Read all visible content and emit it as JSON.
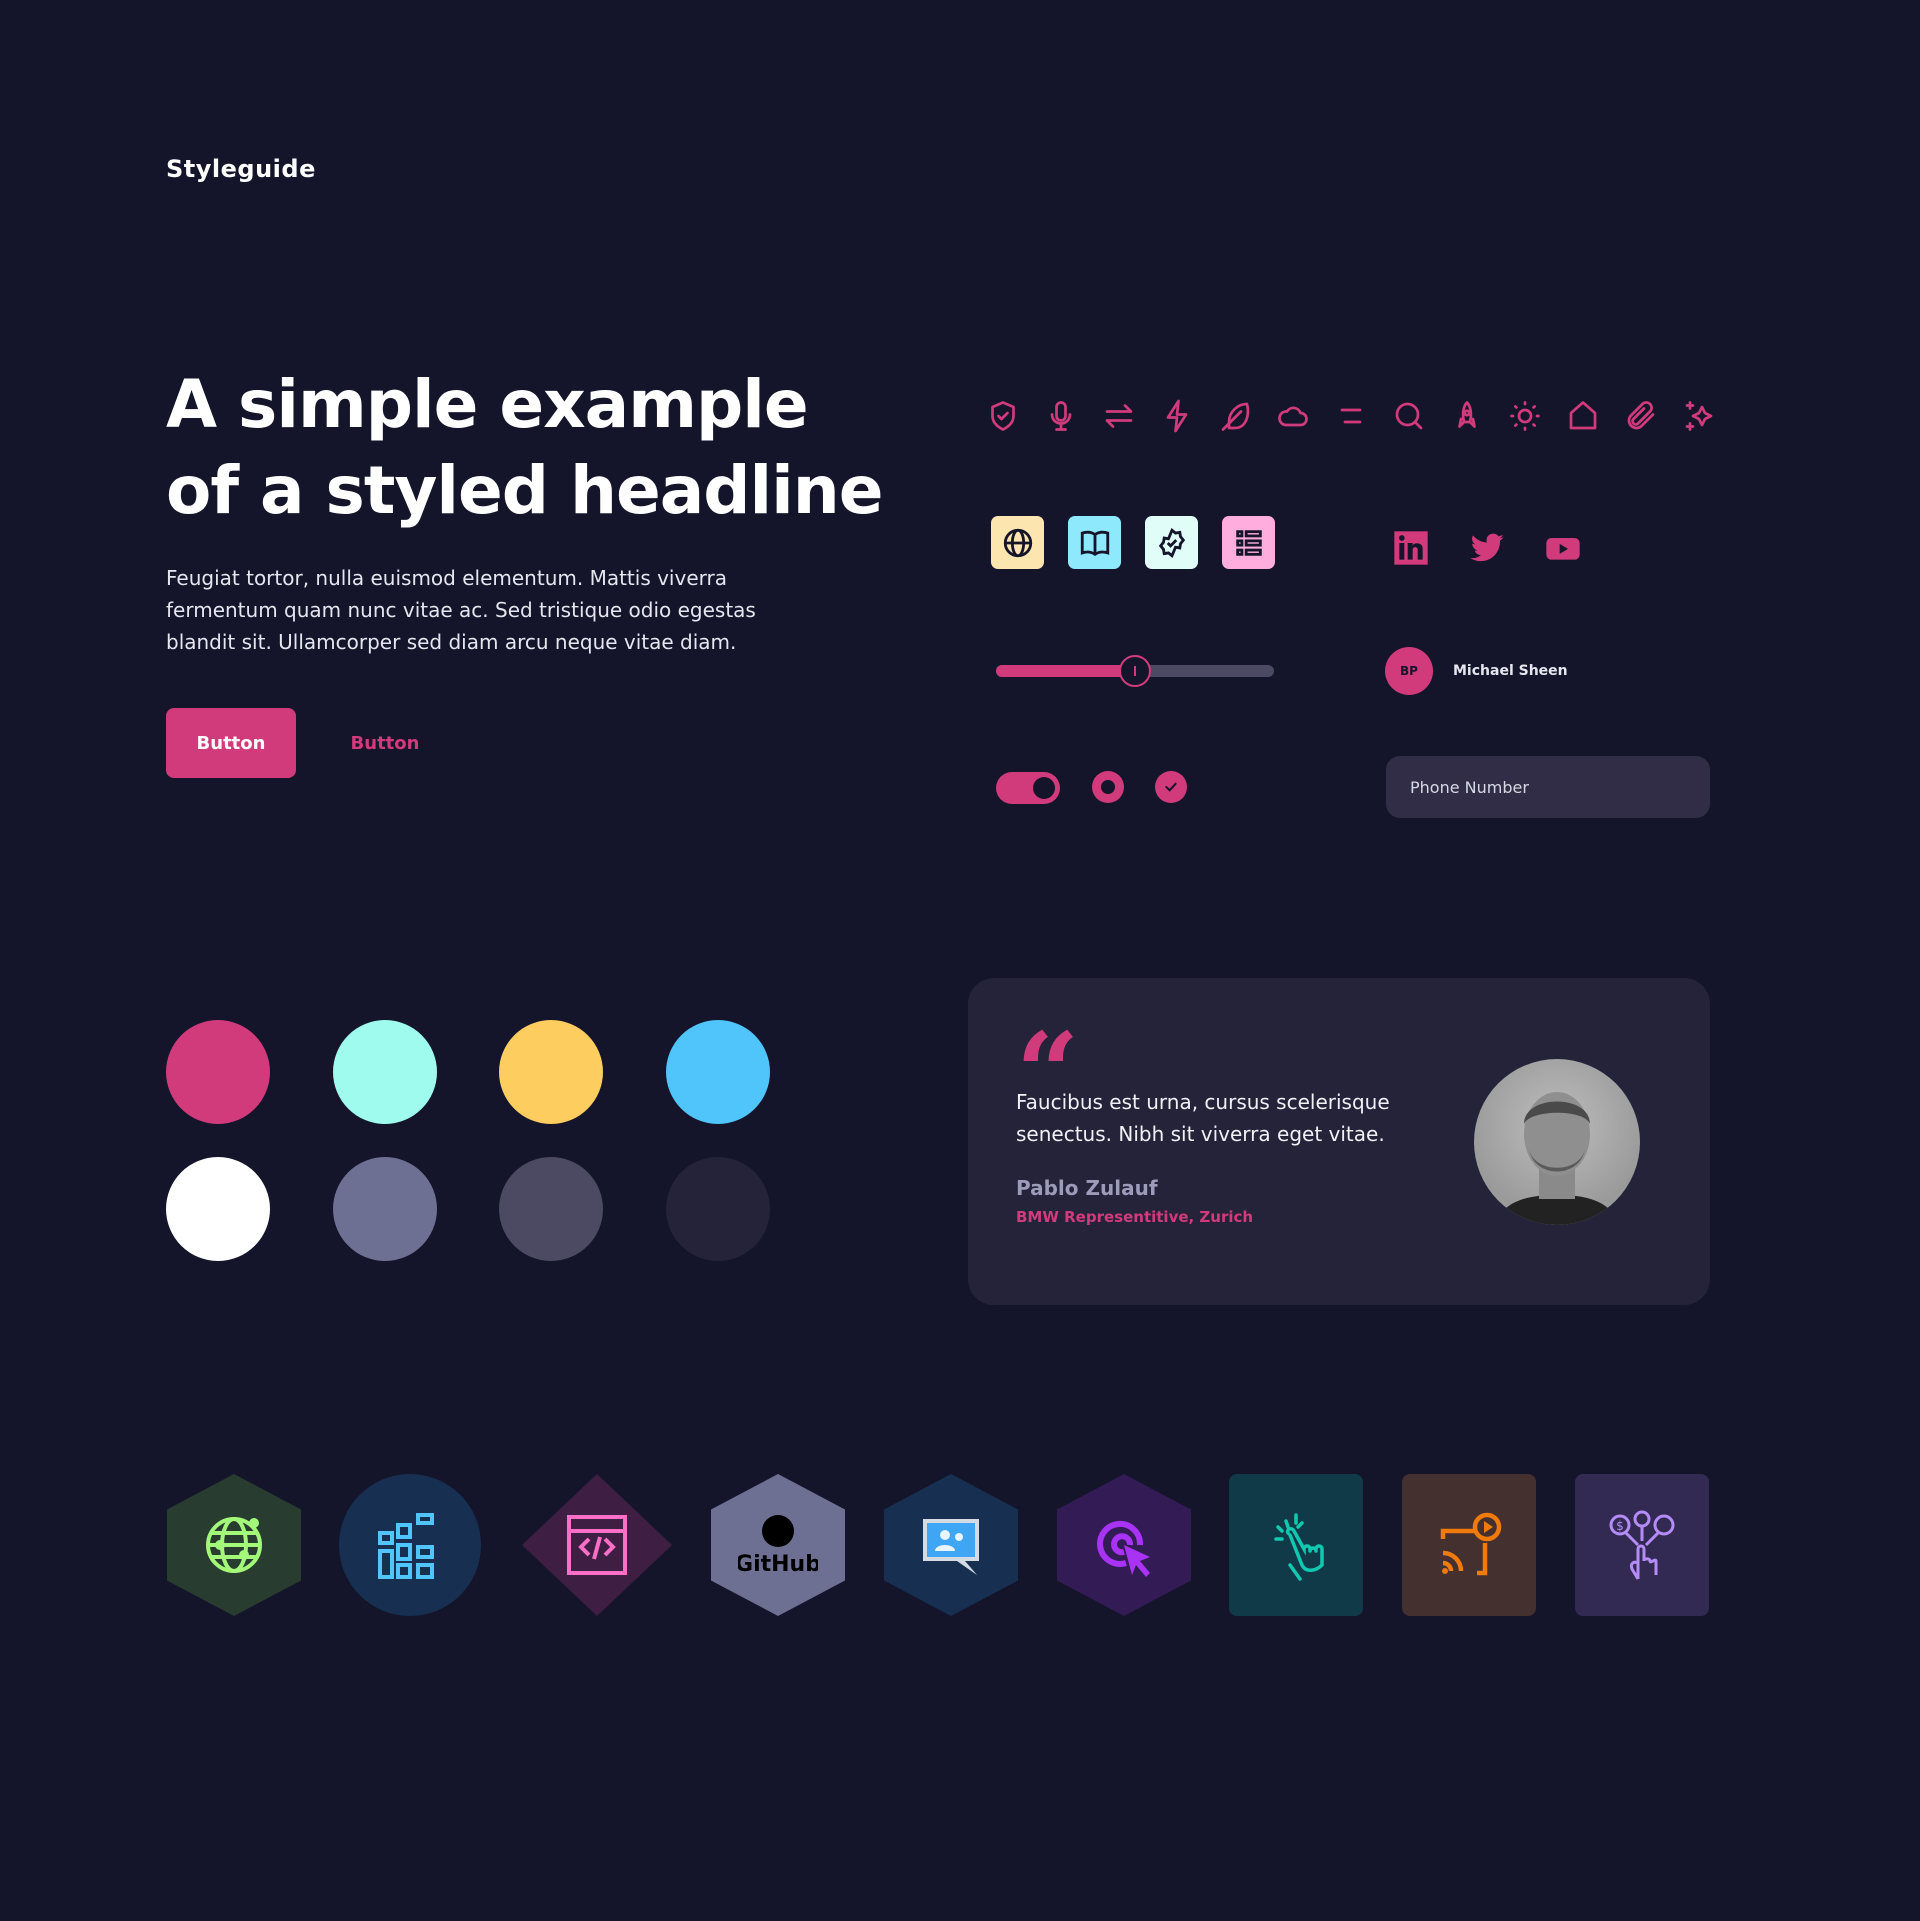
{
  "brand": "Styleguide",
  "hero": {
    "headline": "A simple example of a styled headline",
    "paragraph": "Feugiat tortor, nulla euismod elementum. Mattis viverra fermentum quam nunc vitae ac. Sed tristique odio egestas blandit sit. Ullamcorper sed diam arcu neque vitae diam.",
    "primary_button": "Button",
    "secondary_button": "Button"
  },
  "icons": [
    "shield-check",
    "microphone",
    "arrows-swap",
    "lightning",
    "feather",
    "cloud",
    "menu",
    "search",
    "rocket",
    "sun",
    "home",
    "paperclip",
    "sparkles"
  ],
  "feature_icons": [
    {
      "name": "globe",
      "bg": "#fde5b0"
    },
    {
      "name": "book",
      "bg": "#8fe9fd"
    },
    {
      "name": "badge-check",
      "bg": "#e0fdf8"
    },
    {
      "name": "list",
      "bg": "#feadde"
    }
  ],
  "social": [
    "linkedin",
    "twitter",
    "youtube"
  ],
  "slider": {
    "value": 0.5
  },
  "user": {
    "initials": "BP",
    "name": "Michael Sheen"
  },
  "toggle": {
    "on": true
  },
  "radio": {
    "selected": true
  },
  "checkbox": {
    "checked": true
  },
  "phone": {
    "placeholder": "Phone Number",
    "value": ""
  },
  "palette": [
    "#d13b7b",
    "#9ffbed",
    "#fecd60",
    "#4fc5fc",
    "#ffffff",
    "#6e7093",
    "#4c4a62",
    "#252339"
  ],
  "testimonial": {
    "quote": "Faucibus est urna, cursus scelerisque senectus. Nibh sit viverra eget vitae.",
    "name": "Pablo Zulauf",
    "role": "BMW Representitive, Zurich"
  },
  "badges": [
    {
      "name": "globe-network",
      "bg": "#283c30",
      "color": "#a3f87a",
      "shape": "hex"
    },
    {
      "name": "blocks",
      "bg": "#173052",
      "color": "#4fc5fc",
      "shape": "circle"
    },
    {
      "name": "code-window",
      "bg": "#3e1f43",
      "color": "#ff6fc8",
      "shape": "diamond"
    },
    {
      "name": "github",
      "bg": "#6e7093",
      "color": "#000000",
      "shape": "hex",
      "label": "GitHub"
    },
    {
      "name": "chat-contacts",
      "bg": "#173052",
      "color": "#3fa5f5",
      "shape": "hex"
    },
    {
      "name": "target-cursor",
      "bg": "#331b55",
      "color": "#a833f5",
      "shape": "hex"
    },
    {
      "name": "hand-tap",
      "bg": "#113a48",
      "color": "#10c9b0",
      "shape": "square"
    },
    {
      "name": "cast-play",
      "bg": "#44302f",
      "color": "#f07a0a",
      "shape": "square"
    },
    {
      "name": "hand-finance-settings",
      "bg": "#322a52",
      "color": "#b58cf7",
      "shape": "square"
    }
  ],
  "colors": {
    "background": "#14152a",
    "accent": "#d13b7b",
    "card": "#252339",
    "input": "#312d46"
  }
}
